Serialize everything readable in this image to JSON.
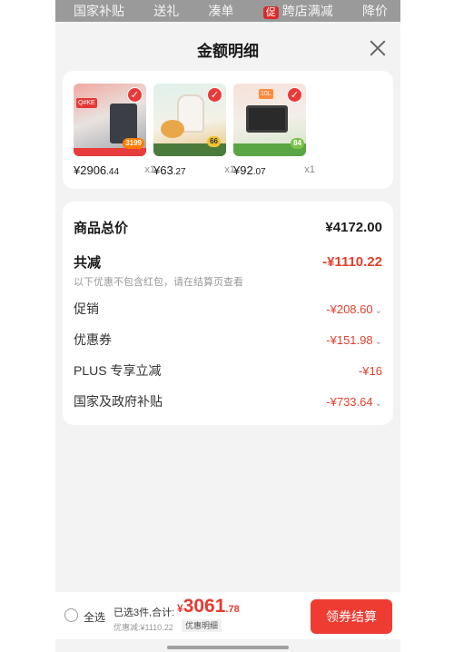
{
  "top_tabs": {
    "items": [
      "国家补贴",
      "送礼",
      "凑单",
      "跨店满减",
      "降价"
    ],
    "badge": "促"
  },
  "sheet": {
    "title": "金额明细"
  },
  "products": [
    {
      "price_int": "¥2906",
      "price_dec": ".44",
      "qty": "x1",
      "tag_text": "Q#KE",
      "price_tag": "3199"
    },
    {
      "price_int": "¥63",
      "price_dec": ".27",
      "qty": "x1",
      "tag_text": "",
      "price_tag": "66"
    },
    {
      "price_int": "¥92",
      "price_dec": ".07",
      "qty": "x1",
      "tag_text": "10L",
      "price_tag": "84"
    }
  ],
  "summary": {
    "total_label": "商品总价",
    "total_value": "¥4172.00",
    "reduce_label": "共减",
    "reduce_value": "-¥1110.22",
    "note": "以下优惠不包含红包，请在结算页查看",
    "items": [
      {
        "label": "促销",
        "value": "-¥208.60"
      },
      {
        "label": "优惠券",
        "value": "-¥151.98"
      },
      {
        "label": "PLUS 专享立减",
        "value": "-¥16"
      },
      {
        "label": "国家及政府补贴",
        "value": "-¥733.64"
      }
    ]
  },
  "bottom_bar": {
    "select_all": "全选",
    "selected_count": "已选3件,合计:",
    "total_symbol": "¥",
    "total_int": "3061",
    "total_dec": ".78",
    "discount": "优惠减:¥1110.22",
    "detail_tag": "优惠明细",
    "checkout": "领券结算"
  },
  "colors": {
    "accent": "#ee3c32",
    "discount_red": "#e2412d"
  }
}
